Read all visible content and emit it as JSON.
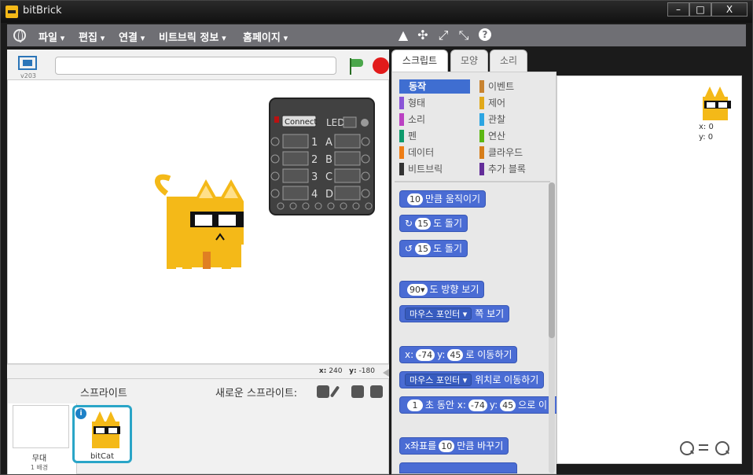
{
  "window": {
    "title": "bitBrick",
    "minimize": "–",
    "maximize": "□",
    "close": "X"
  },
  "menu": {
    "items": [
      "파일",
      "편집",
      "연결",
      "비트브릭 정보",
      "홈페이지"
    ]
  },
  "toolbar": {
    "icons": [
      "stamp-icon",
      "cross-arrows-icon",
      "grow-icon",
      "shrink-icon",
      "help-icon"
    ],
    "help": "?"
  },
  "stage": {
    "version": "v203",
    "coords_x_label": "x:",
    "coords_x": "240",
    "coords_y_label": "y:",
    "coords_y": "-180"
  },
  "hardware": {
    "connect": "Connect",
    "led": "LED",
    "ports_num": [
      "1",
      "2",
      "3",
      "4"
    ],
    "ports_letter": [
      "A",
      "B",
      "C",
      "D"
    ]
  },
  "sprites": {
    "title": "스프라이트",
    "new_sprite": "새로운 스프라이트:",
    "stage_label": "무대",
    "stage_sub": "1 배경",
    "sprite_name": "bitCat",
    "info": "i"
  },
  "tabs": [
    "스크립트",
    "모양",
    "소리"
  ],
  "categories": [
    {
      "label": "동작",
      "color": "#4a6cd4",
      "selected": true
    },
    {
      "label": "형태",
      "color": "#8a55d7"
    },
    {
      "label": "소리",
      "color": "#bb42c3"
    },
    {
      "label": "펜",
      "color": "#0e9a6c"
    },
    {
      "label": "데이터",
      "color": "#ee7d16"
    },
    {
      "label": "비트브릭",
      "color": "#333333"
    },
    {
      "label": "이벤트",
      "color": "#c88330"
    },
    {
      "label": "제어",
      "color": "#e1a91a"
    },
    {
      "label": "관찰",
      "color": "#2ca5e2"
    },
    {
      "label": "연산",
      "color": "#5cb712"
    },
    {
      "label": "클라우드",
      "color": "#d67d1a"
    },
    {
      "label": "추가 블록",
      "color": "#632d99"
    }
  ],
  "blocks": {
    "b1_val": "10",
    "b1_text": "만큼 움직이기",
    "b2_val": "15",
    "b2_text": "도 돌기",
    "b3_val": "15",
    "b3_text": "도 돌기",
    "b4_val": "90▾",
    "b4_text": "도 방향 보기",
    "b5_drop": "마우스 포인터 ▾",
    "b5_text": "쪽 보기",
    "b6_x": "x:",
    "b6_xval": "-74",
    "b6_y": "y:",
    "b6_yval": "45",
    "b6_text": "로 이동하기",
    "b7_drop": "마우스 포인터 ▾",
    "b7_text": "위치로 이동하기",
    "b8_val": "1",
    "b8_text1": "초 동안 x:",
    "b8_xval": "-74",
    "b8_y": "y:",
    "b8_yval": "45",
    "b8_text2": "으로 이",
    "b9_pre": "x좌표를",
    "b9_val": "10",
    "b9_text": "만큼 바꾸기"
  },
  "script_area": {
    "x_label": "x: 0",
    "y_label": "y: 0"
  },
  "colors": {
    "menubar": "#6f6f74",
    "selected_sprite": "#2aa5c7",
    "cat_yellow": "#f4b918"
  }
}
